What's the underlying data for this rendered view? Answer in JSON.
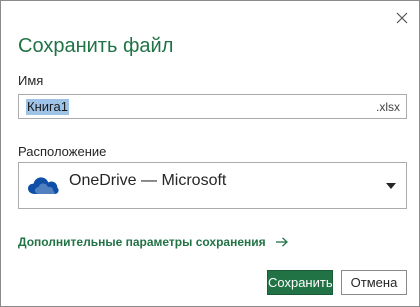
{
  "dialog": {
    "title": "Сохранить файл",
    "name_label": "Имя",
    "file_name": "Книга1",
    "extension": ".xlsx",
    "location_label": "Расположение",
    "location_value": "OneDrive — Microsoft",
    "more_options_link": "Дополнительные параметры сохранения",
    "save_label": "Сохранить",
    "cancel_label": "Отмена"
  },
  "icons": {
    "close": "close-icon",
    "location": "onedrive-cloud-icon",
    "dropdown": "chevron-down-icon",
    "link_arrow": "arrow-right-icon"
  },
  "colors": {
    "accent": "#217346",
    "onedrive": "#0f4fa8",
    "selection": "#9ec3e6"
  }
}
